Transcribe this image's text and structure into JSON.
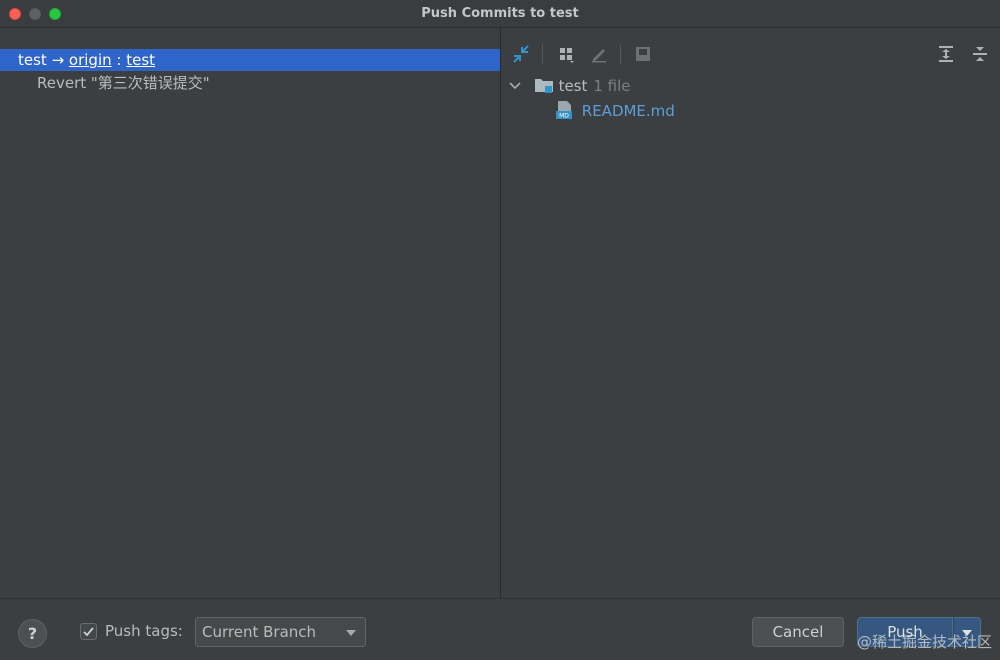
{
  "window": {
    "title": "Push Commits to test"
  },
  "left": {
    "branch": {
      "local": "test",
      "arrow": " → ",
      "remote": "origin",
      "separator": " : ",
      "remote_branch": "test"
    },
    "commit": {
      "message": "Revert \"第三次错误提交\""
    }
  },
  "right": {
    "toolbar": {
      "icons": [
        "expand-diff-icon",
        "group-by-icon",
        "edit-source-icon",
        "save-icon",
        "expand-all-icon",
        "collapse-all-icon"
      ]
    },
    "tree": {
      "folder_name": "test",
      "folder_count": "1 file",
      "file_name": "README.md",
      "file_badge": "MD"
    }
  },
  "bottom": {
    "help_label": "?",
    "push_tags_label": "Push tags:",
    "push_tags_checked": true,
    "tag_scope": "Current Branch",
    "cancel_label": "Cancel",
    "push_label": "Push",
    "watermark": "@稀土掘金技术社区"
  },
  "colors": {
    "selection": "#2f65ca",
    "file_link": "#5d9dd8",
    "push_button": "#365880"
  }
}
